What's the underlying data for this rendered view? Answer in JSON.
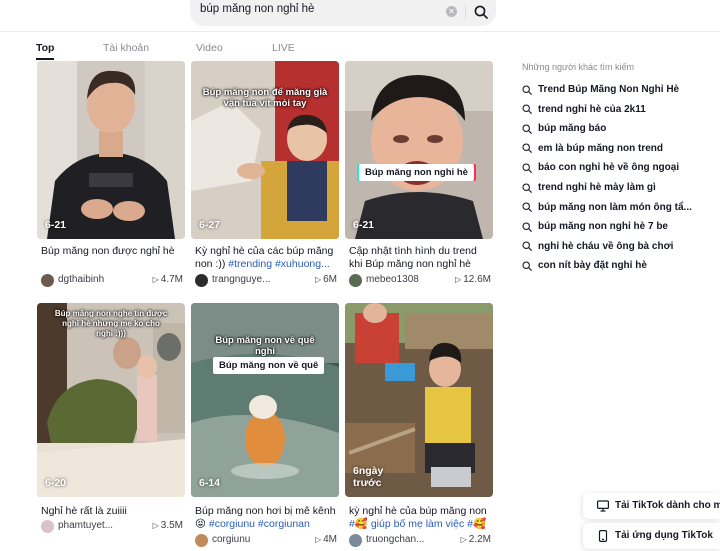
{
  "search": {
    "query": "búp măng non nghỉ hè",
    "clear_icon": "clear-icon",
    "button_icon": "search-icon"
  },
  "tabs": [
    {
      "label": "Top",
      "active": true
    },
    {
      "label": "Tài khoản",
      "active": false
    },
    {
      "label": "Video",
      "active": false
    },
    {
      "label": "LIVE",
      "active": false
    }
  ],
  "videos": [
    {
      "date": "6-21",
      "caption": "Búp măng non được nghỉ hè",
      "username": "dgthaibinh",
      "views": "4.7M"
    },
    {
      "date": "6-27",
      "overlay": "Búp măng non để măng già vận tua vít mỏi tay",
      "caption_text": "Kỳ nghỉ hè của các búp măng non :)) ",
      "caption_tags": "#trending #xuhuong...",
      "username": "trangnguye...",
      "views": "6M"
    },
    {
      "date": "6-21",
      "overlay_label": "Búp măng non nghỉ hè",
      "caption": "Cập nhật tình hình du trend khi Búp măng non nghỉ hè 🔥...",
      "username": "mebeo1308",
      "views": "12.6M"
    },
    {
      "date": "6-20",
      "overlay": "Búp măng non nghe tin được nghỉ hè nhưng mẹ ko cho nghỉ :)))",
      "caption": "Nghỉ hè rất là zuiiii",
      "username": "phamtuyet...",
      "views": "3.5M"
    },
    {
      "date": "6-14",
      "overlay": "Búp măng non về quê nghỉ",
      "overlay_label": "Búp măng non về quê",
      "caption_text": "Búp măng non hơi bị mê kênh 😝 ",
      "caption_tags": "#corgiunu #corgiunan",
      "username": "corgiunu",
      "views": "4M"
    },
    {
      "date": "6ngày trước",
      "caption_text": "kỳ nghỉ hè của búp măng non ",
      "caption_tags": "#🥰 giúp bố mẹ làm việc #🥰",
      "username": "truongchan...",
      "views": "2.2M"
    }
  ],
  "related": {
    "title": "Những người khác tìm kiếm",
    "items": [
      "Trend Búp Măng Non Nghỉ Hè",
      "trend nghỉ hè của 2k11",
      "búp măng báo",
      "em là búp măng non trend",
      "báo con nghỉ hè về ông ngoại",
      "trend nghỉ hè mày làm gì",
      "búp măng non làm món ông tẩ...",
      "búp măng non nghỉ hè 7 be",
      "nghỉ hè cháu về ông bà chơi",
      "con nít bày đặt nghỉ hè"
    ]
  },
  "promos": [
    {
      "label": "Tải TikTok dành cho m",
      "icon": "desktop-icon"
    },
    {
      "label": "Tải ứng dụng TikTok",
      "icon": "phone-icon"
    }
  ],
  "colors": {
    "text": "#161823",
    "muted": "#8a8b91",
    "hashtag": "#2b5db9",
    "search_bg": "#f1f1f2"
  }
}
